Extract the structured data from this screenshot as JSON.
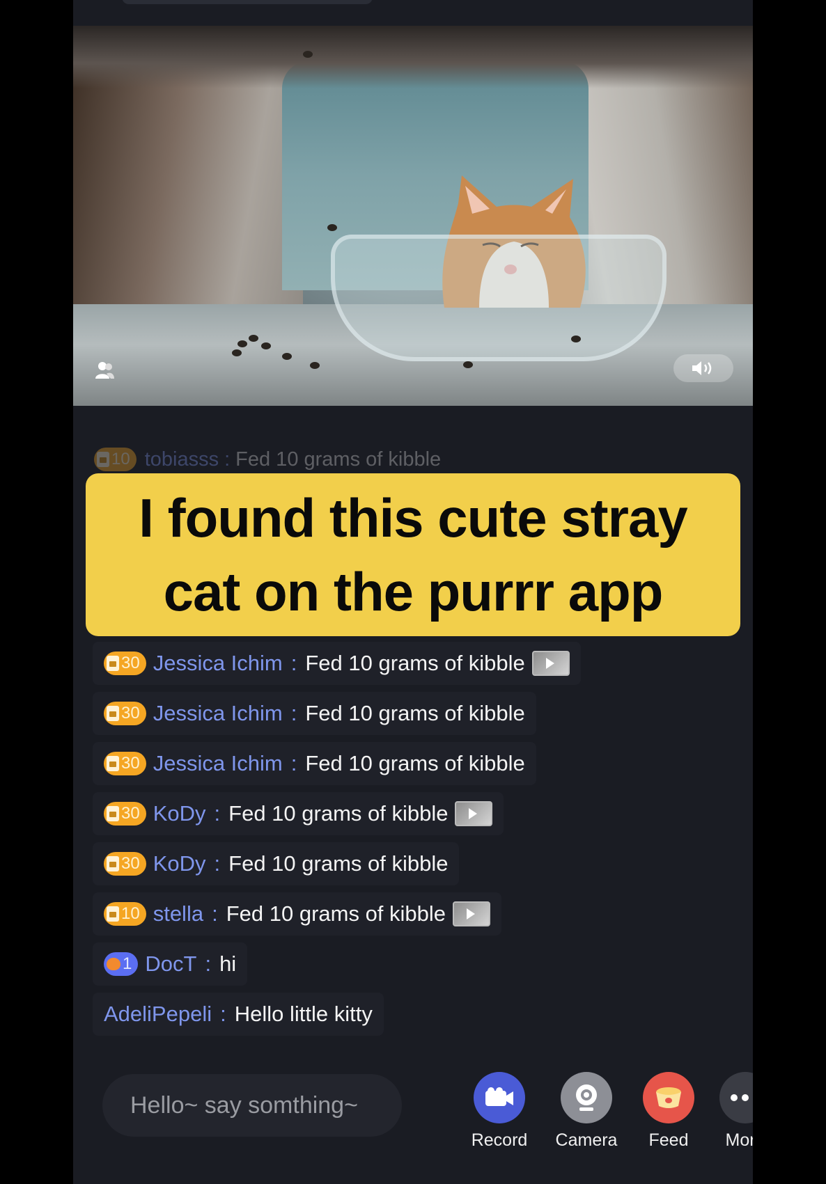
{
  "ghost_message": {
    "badge_count": "10",
    "username": "tobiasss",
    "separator": ":",
    "text": "Fed 10 grams of kibble"
  },
  "banner": {
    "line1": "I found this cute stray",
    "line2": "cat on the purrr app"
  },
  "chat": [
    {
      "badge_type": "kibble",
      "badge_count": "30",
      "username": "Jessica Ichim",
      "text": "Fed 10 grams of kibble",
      "has_clip": true
    },
    {
      "badge_type": "kibble",
      "badge_count": "30",
      "username": "Jessica Ichim",
      "text": "Fed 10 grams of kibble",
      "has_clip": false
    },
    {
      "badge_type": "kibble",
      "badge_count": "30",
      "username": "Jessica Ichim",
      "text": "Fed 10 grams of kibble",
      "has_clip": false
    },
    {
      "badge_type": "kibble",
      "badge_count": "30",
      "username": "KoDy",
      "text": "Fed 10 grams of kibble",
      "has_clip": true
    },
    {
      "badge_type": "kibble",
      "badge_count": "30",
      "username": "KoDy",
      "text": "Fed 10 grams of kibble",
      "has_clip": false
    },
    {
      "badge_type": "kibble",
      "badge_count": "10",
      "username": "stella",
      "text": "Fed 10 grams of kibble",
      "has_clip": true
    },
    {
      "badge_type": "paw",
      "badge_count": "1",
      "username": "DocT",
      "text": "hi",
      "has_clip": false
    },
    {
      "badge_type": "none",
      "badge_count": "",
      "username": "AdeliPepeli",
      "text": "Hello little kitty",
      "has_clip": false
    }
  ],
  "separator": ":",
  "input": {
    "placeholder": "Hello~ say somthing~"
  },
  "actions": [
    {
      "label": "Record",
      "icon": "video-camera-icon",
      "color": "#4a5bd6"
    },
    {
      "label": "Camera",
      "icon": "webcam-icon",
      "color": "#8d8f96"
    },
    {
      "label": "Feed",
      "icon": "food-bowl-icon",
      "color": "#e6554a"
    },
    {
      "label": "More",
      "icon": "more-dots-icon",
      "color": "#3a3c44"
    }
  ],
  "colors": {
    "banner": "#f2cf4b",
    "username": "#7f96ec",
    "badge_kibble": "#f5a623",
    "badge_paw": "#5b6ef2",
    "background": "#1a1c23"
  }
}
